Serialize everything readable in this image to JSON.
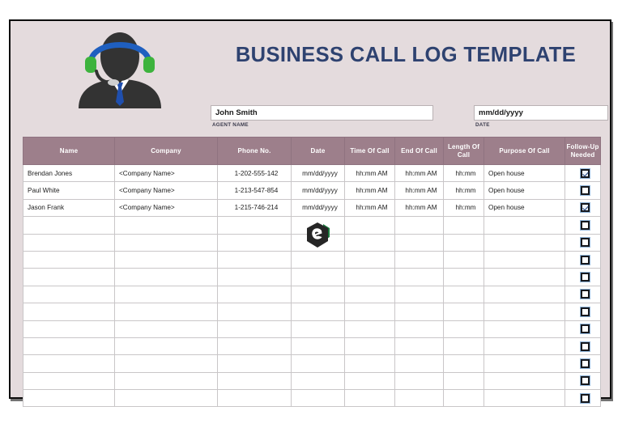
{
  "document": {
    "title": "BUSINESS CALL LOG TEMPLATE",
    "title_color": "#2e4270",
    "background_color": "#e4dbdd",
    "header_row_color": "#9d7f8b"
  },
  "illustration": {
    "name": "call-center-agent-icon",
    "headband_color": "#1f5fbf",
    "earcup_color": "#3db33d",
    "silhouette_color": "#333333",
    "tie_color": "#1f4fae"
  },
  "watermark": {
    "name": "hexagon-e-logo",
    "primary_color": "#262626",
    "accent_color": "#1a7a3c"
  },
  "meta": {
    "agent": {
      "value": "John Smith",
      "label": "AGENT NAME",
      "placeholder": "Agent name"
    },
    "date": {
      "value": "mm/dd/yyyy",
      "label": "DATE",
      "placeholder": "mm/dd/yyyy"
    }
  },
  "table": {
    "columns": [
      "Name",
      "Company",
      "Phone No.",
      "Date",
      "Time Of Call",
      "End Of Call",
      "Length Of Call",
      "Purpose Of Call",
      "Follow-Up Needed"
    ],
    "rows": [
      {
        "name": "Brendan Jones",
        "company": "<Company Name>",
        "phone": "1-202-555-142",
        "date": "mm/dd/yyyy",
        "time_of_call": "hh:mm AM",
        "end_of_call": "hh:mm AM",
        "length_of_call": "hh:mm",
        "purpose": "Open house",
        "follow_up": true
      },
      {
        "name": "Paul White",
        "company": "<Company Name>",
        "phone": "1-213-547-854",
        "date": "mm/dd/yyyy",
        "time_of_call": "hh:mm AM",
        "end_of_call": "hh:mm AM",
        "length_of_call": "hh:mm",
        "purpose": "Open house",
        "follow_up": false
      },
      {
        "name": "Jason Frank",
        "company": "<Company Name>",
        "phone": "1-215-746-214",
        "date": "mm/dd/yyyy",
        "time_of_call": "hh:mm AM",
        "end_of_call": "hh:mm AM",
        "length_of_call": "hh:mm",
        "purpose": "Open house",
        "follow_up": true
      },
      {
        "name": "",
        "company": "",
        "phone": "",
        "date": "",
        "time_of_call": "",
        "end_of_call": "",
        "length_of_call": "",
        "purpose": "",
        "follow_up": false
      },
      {
        "name": "",
        "company": "",
        "phone": "",
        "date": "",
        "time_of_call": "",
        "end_of_call": "",
        "length_of_call": "",
        "purpose": "",
        "follow_up": false
      },
      {
        "name": "",
        "company": "",
        "phone": "",
        "date": "",
        "time_of_call": "",
        "end_of_call": "",
        "length_of_call": "",
        "purpose": "",
        "follow_up": false
      },
      {
        "name": "",
        "company": "",
        "phone": "",
        "date": "",
        "time_of_call": "",
        "end_of_call": "",
        "length_of_call": "",
        "purpose": "",
        "follow_up": false
      },
      {
        "name": "",
        "company": "",
        "phone": "",
        "date": "",
        "time_of_call": "",
        "end_of_call": "",
        "length_of_call": "",
        "purpose": "",
        "follow_up": false
      },
      {
        "name": "",
        "company": "",
        "phone": "",
        "date": "",
        "time_of_call": "",
        "end_of_call": "",
        "length_of_call": "",
        "purpose": "",
        "follow_up": false
      },
      {
        "name": "",
        "company": "",
        "phone": "",
        "date": "",
        "time_of_call": "",
        "end_of_call": "",
        "length_of_call": "",
        "purpose": "",
        "follow_up": false
      },
      {
        "name": "",
        "company": "",
        "phone": "",
        "date": "",
        "time_of_call": "",
        "end_of_call": "",
        "length_of_call": "",
        "purpose": "",
        "follow_up": false
      },
      {
        "name": "",
        "company": "",
        "phone": "",
        "date": "",
        "time_of_call": "",
        "end_of_call": "",
        "length_of_call": "",
        "purpose": "",
        "follow_up": false
      },
      {
        "name": "",
        "company": "",
        "phone": "",
        "date": "",
        "time_of_call": "",
        "end_of_call": "",
        "length_of_call": "",
        "purpose": "",
        "follow_up": false
      },
      {
        "name": "",
        "company": "",
        "phone": "",
        "date": "",
        "time_of_call": "",
        "end_of_call": "",
        "length_of_call": "",
        "purpose": "",
        "follow_up": false
      }
    ]
  }
}
